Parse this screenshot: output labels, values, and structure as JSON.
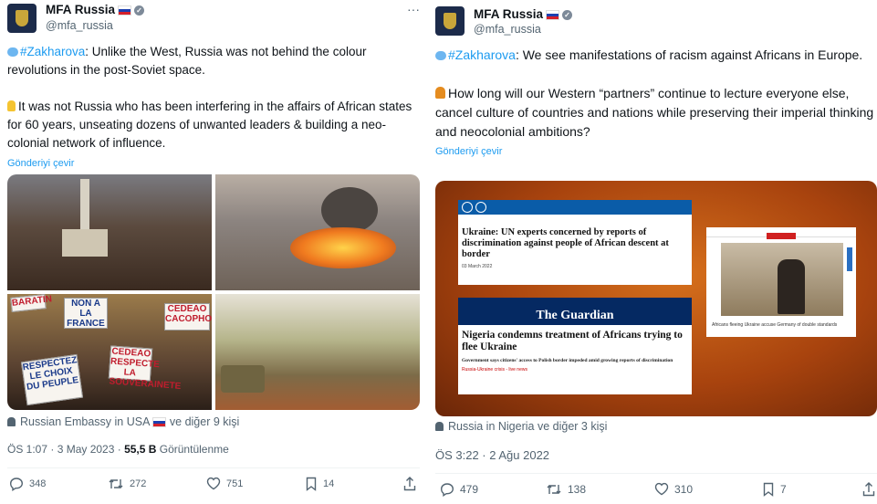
{
  "tweet1": {
    "account_name": "MFA Russia",
    "handle": "@mfa_russia",
    "more": "···",
    "hashtag": "#Zakharova",
    "line1_rest": ": Unlike the West, Russia was not behind the colour revolutions in the post-Soviet space.",
    "line2": "It was not Russia who has been interfering in the affairs of African states for 60 years, unseating dozens of unwanted leaders & building a neo-colonial network of influence.",
    "translate": "Gönderiyi çevir",
    "signs": [
      "BARATIN",
      "NON A LA FRANCE",
      "CEDEAO CACOPHONIE",
      "RESPECTEZ LE CHOIX DU PEUPLE",
      "CEDEAO RESPECTE LA SOUVERAINETE"
    ],
    "reposted_by": "Russian Embassy in USA",
    "reposted_suffix": "ve diğer 9 kişi",
    "time": "ÖS 1:07 · 3 May 2023 · ",
    "views": "55,5 B",
    "views_label": " Görüntülenme",
    "replies": "348",
    "reposts": "272",
    "likes": "751",
    "bookmarks": "14"
  },
  "tweet2": {
    "account_name": "MFA Russia",
    "handle": "@mfa_russia",
    "hashtag": "#Zakharova",
    "line1_rest": ": We see manifestations of racism against Africans in Europe.",
    "line2": "How long will our Western “partners” continue to lecture everyone else, cancel culture of countries and nations while preserving their imperial thinking and neocolonial ambitions?",
    "translate": "Gönderiyi çevir",
    "un_headline": "Ukraine: UN experts concerned by reports of discrimination against people of African descent at border",
    "un_date": "03 March 2022",
    "guardian_logo": "The Guardian",
    "guardian_headline": "Nigeria condemns treatment of Africans trying to flee Ukraine",
    "guardian_sub": "Government says citizens' access to Polish border impeded amid growing reports of discrimination",
    "guardian_link": "Russia-Ukraine crisis - live news",
    "dw_caption": "Africans fleeing Ukraine accuse Germany of double standards",
    "reposted_by": "Russia in Nigeria",
    "reposted_suffix": "ve diğer 3 kişi",
    "time": "ÖS 3:22 · 2 Ağu 2022",
    "replies": "479",
    "reposts": "138",
    "likes": "310",
    "bookmarks": "7"
  },
  "colors": {
    "link": "#1d9bf0",
    "muted": "#536471",
    "text": "#0f1419"
  }
}
